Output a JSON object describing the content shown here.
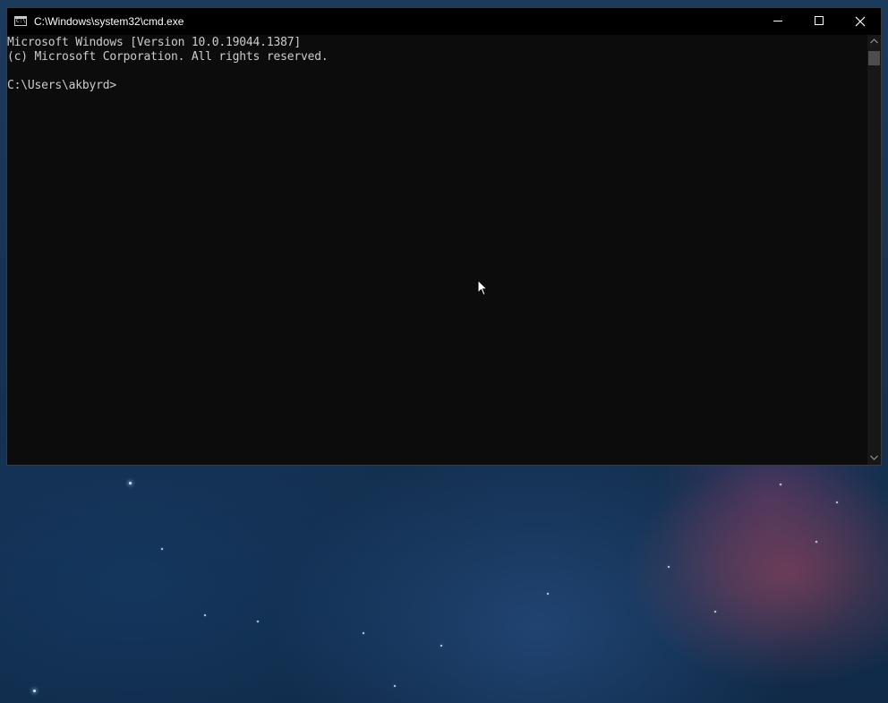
{
  "window": {
    "title": "C:\\Windows\\system32\\cmd.exe",
    "icon": "cmd-icon",
    "icon_prompt": "C:\\",
    "controls": {
      "minimize_icon": "minimize-icon",
      "maximize_icon": "maximize-icon",
      "close_icon": "close-icon"
    }
  },
  "console": {
    "lines": [
      "Microsoft Windows [Version 10.0.19044.1387]",
      "(c) Microsoft Corporation. All rights reserved.",
      "",
      "C:\\Users\\akbyrd>"
    ],
    "text_color": "#cccccc",
    "background_color": "#0c0c0c"
  },
  "scrollbar": {
    "up_icon": "chevron-up-icon",
    "down_icon": "chevron-down-icon"
  },
  "desktop": {
    "wallpaper": "space-nebula"
  }
}
